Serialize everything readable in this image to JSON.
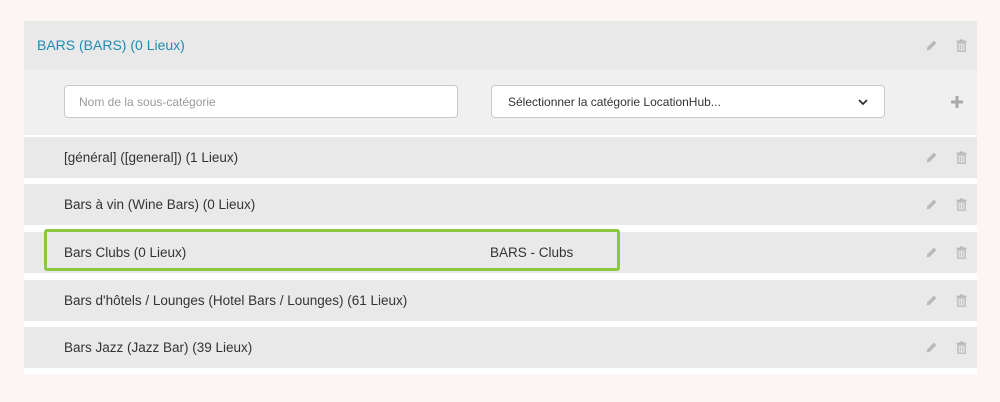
{
  "category": {
    "title": "BARS (BARS) (0 Lieux)"
  },
  "form": {
    "name_placeholder": "Nom de la sous-catégorie",
    "select_value": "Sélectionner la catégorie LocationHub..."
  },
  "subcategories": [
    {
      "label": "[général] ([general])  (1 Lieux)",
      "mapped": ""
    },
    {
      "label": "Bars à vin (Wine Bars)  (0 Lieux)",
      "mapped": ""
    },
    {
      "label": "Bars Clubs  (0 Lieux)",
      "mapped": "BARS - Clubs"
    },
    {
      "label": "Bars d'hôtels / Lounges (Hotel Bars / Lounges)  (61 Lieux)",
      "mapped": ""
    },
    {
      "label": "Bars Jazz (Jazz Bar)  (39 Lieux)",
      "mapped": ""
    }
  ],
  "icons": {
    "edit": "pencil-icon",
    "delete": "trash-icon",
    "add": "plus-icon",
    "dropdown": "chevron-down-icon"
  },
  "colors": {
    "link": "#1f8bb5",
    "highlight": "#8dc63f",
    "row_bg": "#e9e9e9"
  }
}
